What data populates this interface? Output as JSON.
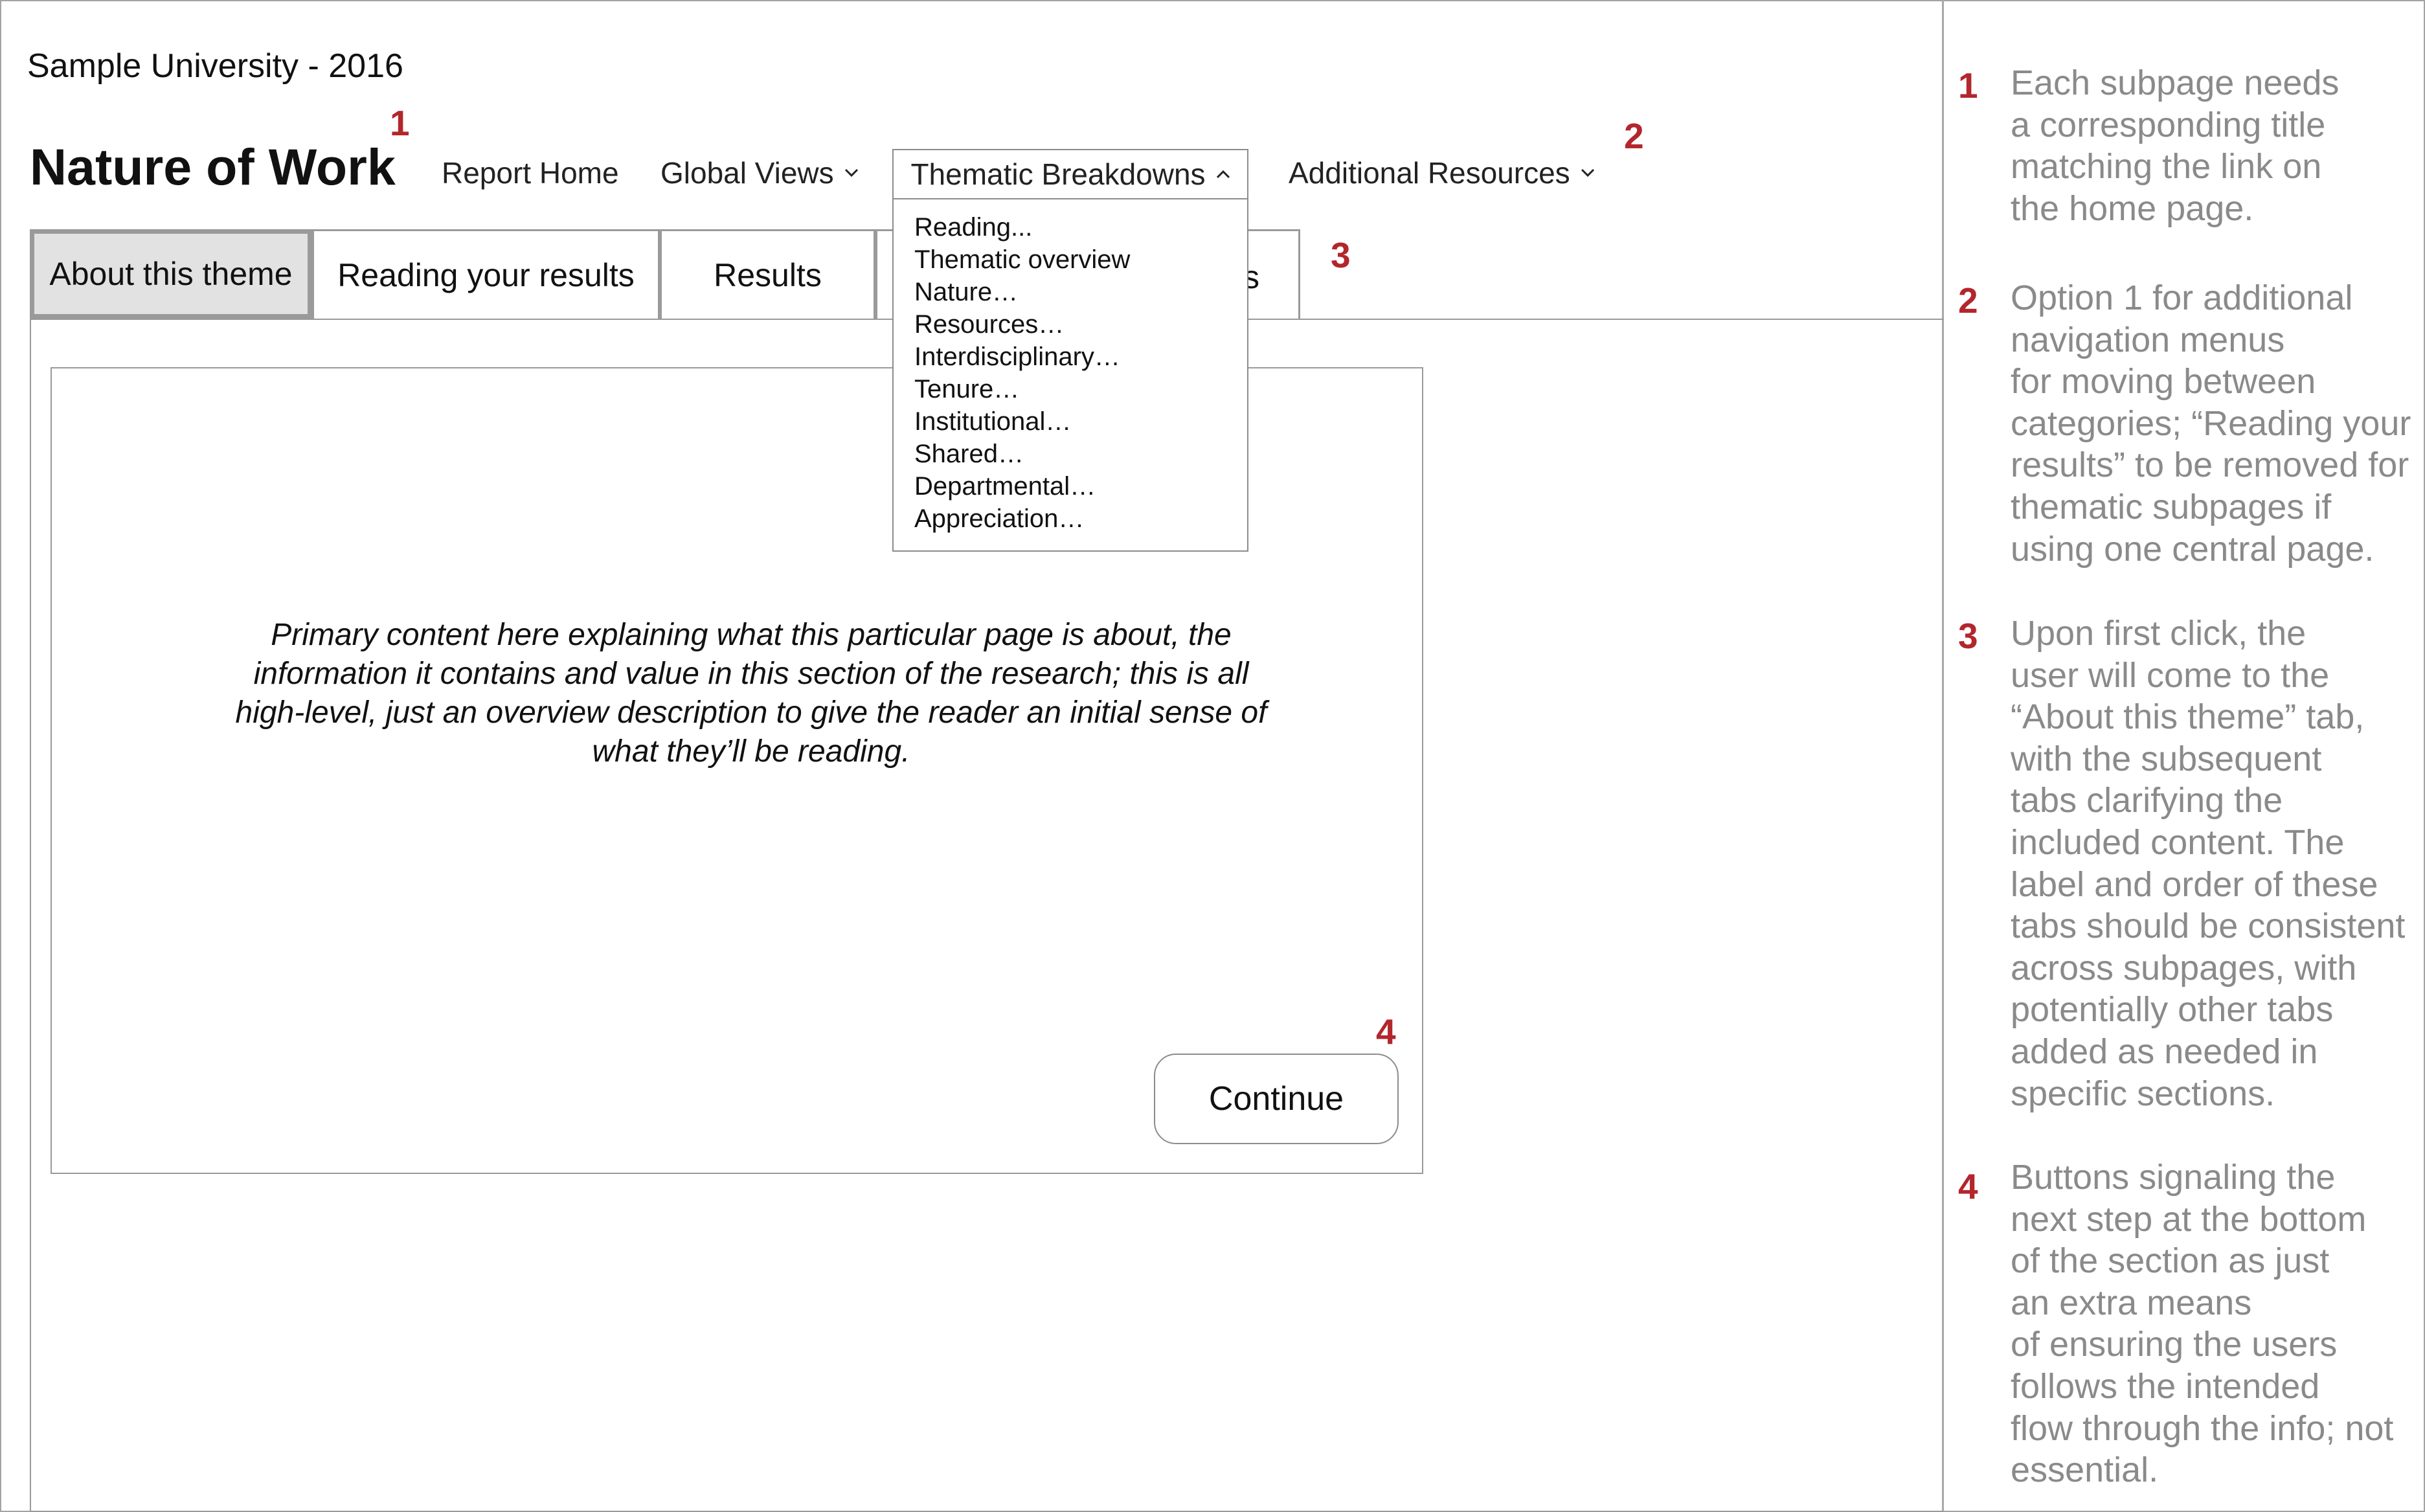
{
  "site": {
    "title": "Sample University - 2016"
  },
  "page": {
    "title": "Nature of Work"
  },
  "nav": {
    "report_home": "Report Home",
    "global_views": "Global Views",
    "thematic_breakdowns": "Thematic Breakdowns",
    "additional_resources": "Additional Resources"
  },
  "dropdown": {
    "items": [
      "Reading...",
      "Thematic overview",
      "Nature…",
      "Resources…",
      "Interdisciplinary…",
      "Tenure…",
      "Institutional…",
      "Shared…",
      "Departmental…",
      "Appreciation…"
    ]
  },
  "tabs": [
    {
      "label": "About this theme",
      "active": true
    },
    {
      "label": "Reading your results",
      "active": false
    },
    {
      "label": "Results",
      "active": false
    },
    {
      "label": "s",
      "active": false
    }
  ],
  "content": {
    "text": "Primary content here explaining what this particular page is about, the information it contains and value in this section of the research; this is all high-level, just an overview description to give the reader an initial sense of what they’ll be reading.",
    "continue_label": "Continue"
  },
  "markers": [
    "1",
    "2",
    "3",
    "4"
  ],
  "notes": [
    {
      "num": "1",
      "lines": [
        "Each subpage needs",
        "a corresponding title",
        "matching the link on",
        "the home page."
      ]
    },
    {
      "num": "2",
      "lines": [
        "Option 1 for additional",
        "navigation menus",
        "for moving between",
        "categories; “Reading your",
        "results” to be removed for",
        "thematic subpages if",
        "using one central page."
      ]
    },
    {
      "num": "3",
      "lines": [
        "Upon first click, the",
        "user will come to the",
        "“About this theme” tab,",
        "with the subsequent",
        "tabs clarifying the",
        "included content. The",
        "label and order of these",
        "tabs should be consistent",
        "across subpages, with",
        "potentially other tabs",
        "added as needed in",
        "specific sections."
      ]
    },
    {
      "num": "4",
      "lines": [
        "Buttons signaling the",
        "next step at the bottom",
        "of the section as just",
        "an extra means",
        "of ensuring the users",
        "follows the intended",
        "flow through the info; not",
        "essential."
      ]
    }
  ],
  "colors": {
    "marker": "#b3262c",
    "note_text": "#8a8a8a",
    "tab_active_bg": "#e2e2e2"
  }
}
